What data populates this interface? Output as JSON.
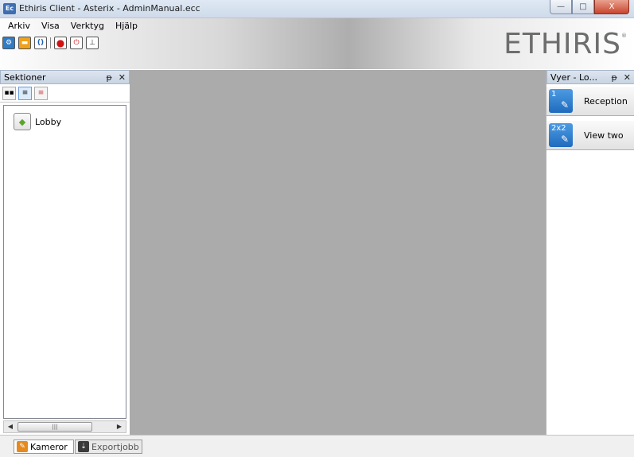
{
  "window": {
    "app_icon": "Ec",
    "title": "Ethiris Client - Asterix - AdminManual.ecc",
    "minimize": "—",
    "maximize": "□",
    "close": "X"
  },
  "menu": {
    "items": [
      "Arkiv",
      "Visa",
      "Verktyg",
      "Hjälp"
    ]
  },
  "toolbar": {
    "icons": [
      "settings-icon",
      "open-folder-icon",
      "reload-icon",
      "record-icon",
      "power-icon",
      "export-icon"
    ]
  },
  "logo": {
    "text": "ETHIRIS"
  },
  "left_panel": {
    "title": "Sektioner",
    "pin": "ᵽ",
    "close": "✕",
    "tree": [
      {
        "label": "Lobby"
      }
    ],
    "scroll_thumb": "|||"
  },
  "right_panel": {
    "title": "Vyer - Lo...",
    "pin": "ᵽ",
    "close": "✕",
    "views": [
      {
        "badge": "1",
        "label": "Reception"
      },
      {
        "badge": "2x2",
        "label": "View two"
      }
    ]
  },
  "bottom_tabs": [
    {
      "label": "Kameror",
      "active": true
    },
    {
      "label": "Exportjobb",
      "active": false
    }
  ],
  "colors": {
    "workspace": "#ababab",
    "view_tile_icon": "#1f6bbd",
    "close_button": "#c8452d"
  }
}
